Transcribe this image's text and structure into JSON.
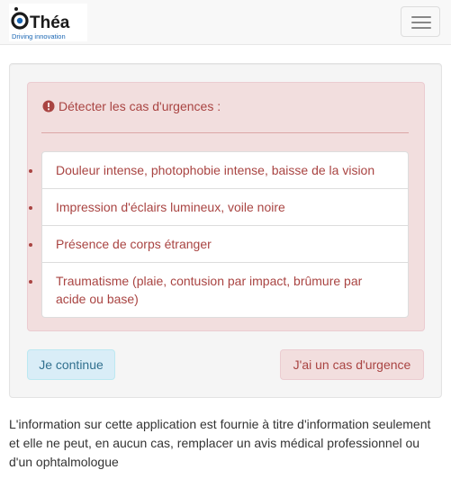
{
  "navbar": {
    "logo_text": "Théa",
    "logo_tagline": "Driving innovation",
    "menu_icon": "hamburger-menu-icon"
  },
  "alert": {
    "icon": "exclamation-circle-icon",
    "title": "Détecter les cas d'urgences :",
    "items": [
      "Douleur intense, photophobie intense, baisse de la vision",
      "Impression d'éclairs lumineux, voile noire",
      "Présence de corps étranger",
      "Traumatisme (plaie, contusion par impact, brûmure par acide ou base)"
    ]
  },
  "buttons": {
    "continue_label": "Je continue",
    "emergency_label": "J'ai un cas d'urgence"
  },
  "disclaimer": "L'information sur cette application est fournie à titre d'information seulement et elle ne peut, en aucun cas, remplacer un avis médical professionnel ou d'un ophtalmologue",
  "colors": {
    "danger_text": "#a94442",
    "danger_bg": "#f2dede",
    "info_text": "#31708f",
    "info_bg": "#d9edf7",
    "brand_blue": "#1a66b3"
  }
}
